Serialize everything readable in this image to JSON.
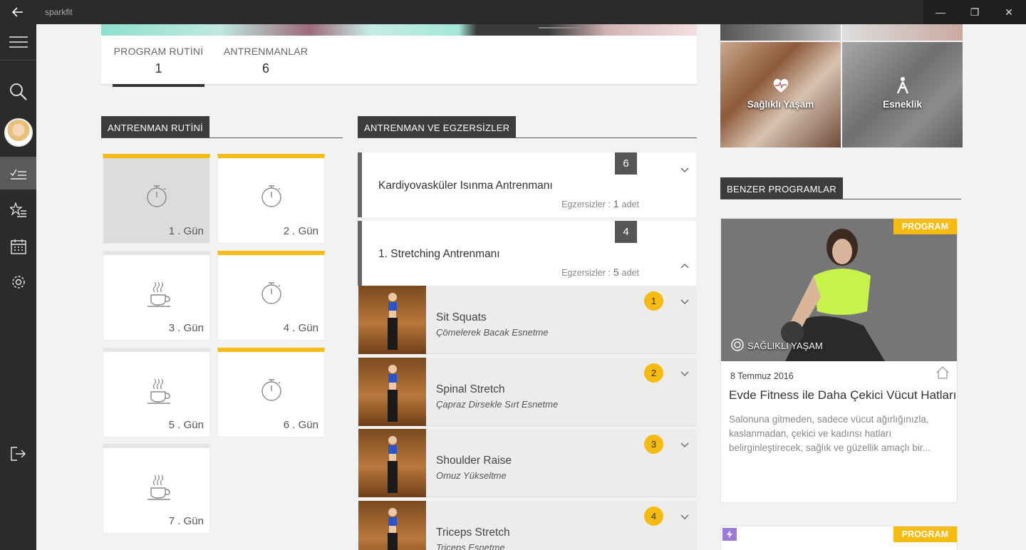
{
  "app": {
    "title": "sparkfit"
  },
  "window": {
    "minimize": "—",
    "maximize": "❐",
    "close": "✕"
  },
  "tabs": [
    {
      "label": "PROGRAM RUTİNİ",
      "value": "1",
      "active": true
    },
    {
      "label": "ANTRENMANLAR",
      "value": "6",
      "active": false
    }
  ],
  "routine": {
    "heading": "ANTRENMAN RUTİNİ",
    "days": [
      {
        "label": "1 . Gün",
        "type": "workout",
        "highlight": true,
        "selected": true
      },
      {
        "label": "2 . Gün",
        "type": "workout",
        "highlight": true,
        "selected": false
      },
      {
        "label": "3 . Gün",
        "type": "rest",
        "highlight": false,
        "selected": false
      },
      {
        "label": "4 . Gün",
        "type": "workout",
        "highlight": true,
        "selected": false
      },
      {
        "label": "5 . Gün",
        "type": "rest",
        "highlight": false,
        "selected": false
      },
      {
        "label": "6 . Gün",
        "type": "workout",
        "highlight": true,
        "selected": false
      },
      {
        "label": "7 . Gün",
        "type": "rest",
        "highlight": false,
        "selected": false
      }
    ]
  },
  "workouts": {
    "heading": "ANTRENMAN VE EGZERSİZLER",
    "count_label": "Egzersizler :",
    "unit": "adet",
    "items": [
      {
        "badge": "6",
        "title": "Kardiyovasküler Isınma Antrenmanı",
        "count": "1",
        "expanded": false
      },
      {
        "badge": "4",
        "title": "1. Stretching Antrenmanı",
        "count": "5",
        "expanded": true
      }
    ],
    "exercises": [
      {
        "num": "1",
        "name": "Sit Squats",
        "sub": "Çömelerek Bacak Esnetme"
      },
      {
        "num": "2",
        "name": "Spinal Stretch",
        "sub": "Çapraz Dirsekle Sırt Esnetme"
      },
      {
        "num": "3",
        "name": "Shoulder  Raise",
        "sub": "Omuz Yükseltme"
      },
      {
        "num": "4",
        "name": "Triceps Stretch",
        "sub": "Triceps Esnetme"
      }
    ]
  },
  "categories": [
    {
      "label": "Sağlıklı Yaşam",
      "icon": "heart-pulse-icon"
    },
    {
      "label": "Esneklik",
      "icon": "stretch-figure-icon"
    }
  ],
  "similar": {
    "heading": "BENZER  PROGRAMLAR",
    "cards": [
      {
        "tag": "PROGRAM",
        "category": "SAĞLIKLI YAŞAM",
        "date": "8 Temmuz 2016",
        "title": "Evde Fitness ile Daha Çekici Vücut Hatları",
        "desc": "Salonuna gitmeden, sadece vücut ağırlığınızla, kaslanmadan, çekici ve kadınsı hatları belirginleştirecek, sağlık ve güzellik amaçlı bir..."
      },
      {
        "tag": "PROGRAM"
      }
    ]
  },
  "colors": {
    "accent": "#f5bb12",
    "rail": "#2b2b2b",
    "header": "#3c3c3c"
  }
}
